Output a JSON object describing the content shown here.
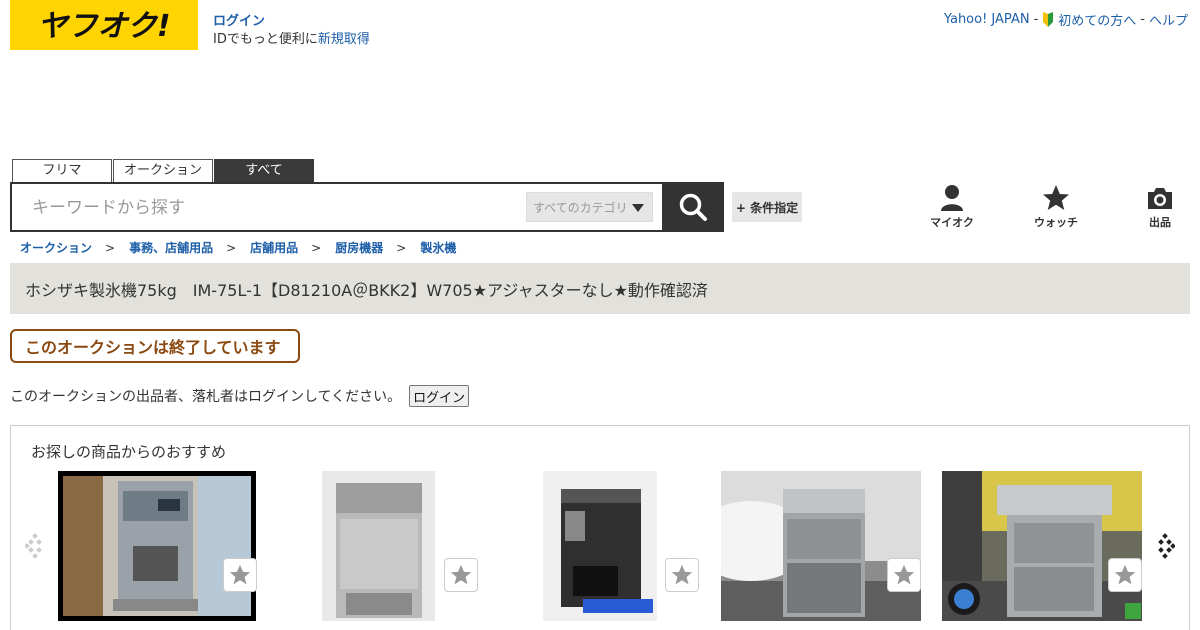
{
  "header": {
    "logo_text": "ヤフオク!",
    "login_link": "ログイン",
    "login_sub_prefix": "IDでもっと便利に",
    "login_sub_link": "新規取得",
    "top_links": {
      "yahoo": "Yahoo! JAPAN",
      "sep": "-",
      "beginners": "初めての方へ",
      "help": "ヘルプ"
    }
  },
  "tabs": [
    {
      "label": "フリマ"
    },
    {
      "label": "オークション"
    },
    {
      "label": "すべて",
      "active": true
    }
  ],
  "search": {
    "placeholder": "キーワードから探す",
    "category": "すべてのカテゴリ",
    "condition_button": "+ 条件指定"
  },
  "nav": {
    "myauc": "マイオク",
    "watch": "ウォッチ",
    "sell": "出品"
  },
  "breadcrumb": [
    "オークション",
    "事務、店舗用品",
    "店舗用品",
    "厨房機器",
    "製氷機"
  ],
  "breadcrumb_sep": ">",
  "item_title": "ホシザキ製氷機75kg　IM-75L-1【D81210A＠BKK2】W705★アジャスターなし★動作確認済",
  "ended_badge": "このオークションは終了しています",
  "notice": {
    "text": "このオークションの出品者、落札者はログインしてください。",
    "button": "ログイン"
  },
  "recommend": {
    "title": "お探しの商品からのおすすめ",
    "items": [
      {
        "name": "ice-dispenser-1"
      },
      {
        "name": "ice-maker-2"
      },
      {
        "name": "ice-dispenser-3"
      },
      {
        "name": "ice-maker-4"
      },
      {
        "name": "ice-maker-5"
      }
    ]
  },
  "colors": {
    "brand_yellow": "#ffd400",
    "link_blue": "#1e5fa8",
    "ended_brown": "#8a4a12",
    "title_band": "#e2e1dc"
  }
}
